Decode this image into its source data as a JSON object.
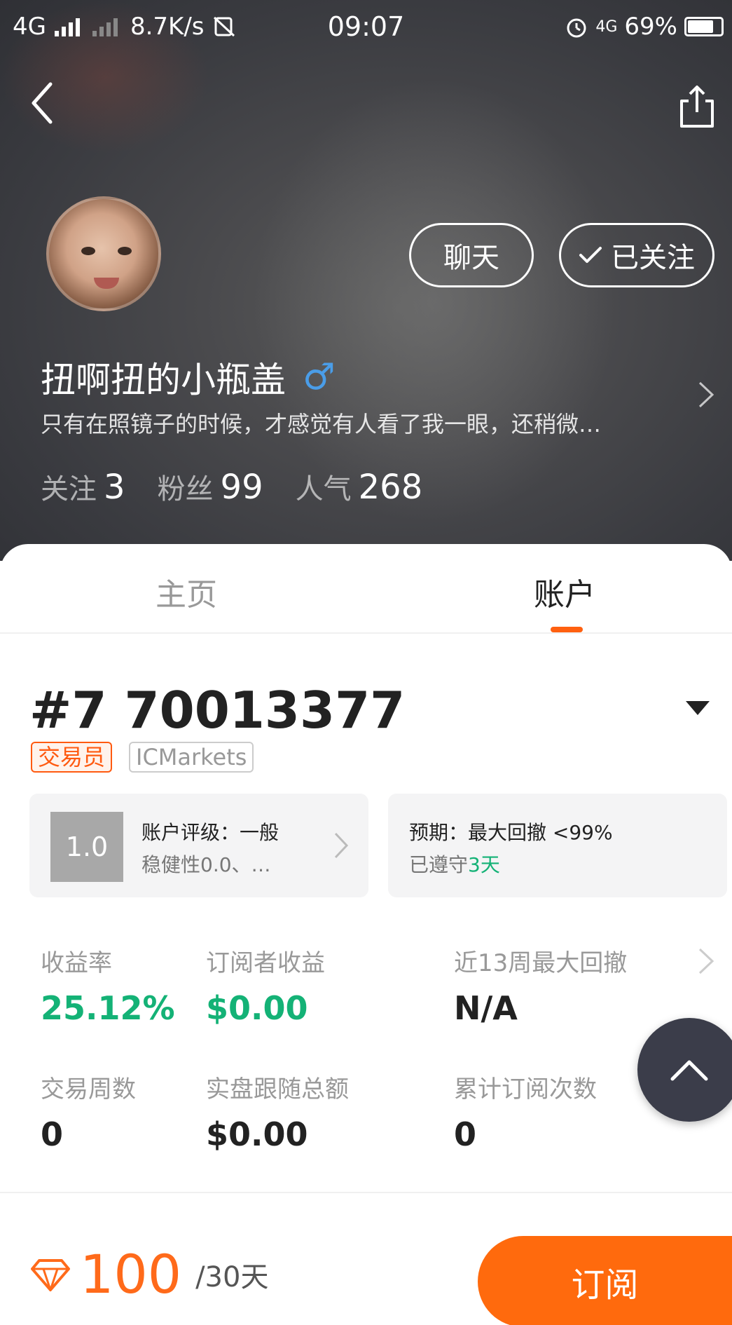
{
  "status_bar": {
    "network": "4G",
    "speed": "8.7K/s",
    "time": "09:07",
    "network_right": "4G",
    "battery": "69%"
  },
  "profile": {
    "username": "扭啊扭的小瓶盖",
    "gender_symbol": "♂",
    "bio": "只有在照镜子的时候，才感觉有人看了我一眼，还稍微…",
    "chat_label": "聊天",
    "follow_label": "已关注",
    "stats": [
      {
        "label": "关注",
        "value": "3"
      },
      {
        "label": "粉丝",
        "value": "99"
      },
      {
        "label": "人气",
        "value": "268"
      }
    ]
  },
  "tabs": [
    {
      "label": "主页",
      "active": false
    },
    {
      "label": "账户",
      "active": true
    }
  ],
  "account": {
    "number": "#7 70013377",
    "tag_trader": "交易员",
    "tag_broker": "ICMarkets",
    "rating_value": "1.0",
    "rating_title": "账户评级：一般",
    "rating_sub": "稳健性0.0、…",
    "expect_title": "预期：最大回撤 <99%",
    "expect_sub_prefix": "已遵守",
    "expect_sub_days": "3天"
  },
  "metrics": [
    {
      "label": "收益率",
      "value": "25.12%",
      "color": "#14b276"
    },
    {
      "label": "订阅者收益",
      "value": "$0.00",
      "color": "#14b276"
    },
    {
      "label": "近13周最大回撤",
      "value": "N/A",
      "color": "#222222"
    },
    {
      "label": "交易周数",
      "value": "0",
      "color": "#222222"
    },
    {
      "label": "实盘跟随总额",
      "value": "$0.00",
      "color": "#222222"
    },
    {
      "label": "累计订阅次数",
      "value": "0",
      "color": "#222222"
    }
  ],
  "footer": {
    "price": "100",
    "unit": "/30天",
    "subscribe_label": "订阅"
  },
  "colors": {
    "accent": "#ff6a0d",
    "green": "#14b276"
  }
}
